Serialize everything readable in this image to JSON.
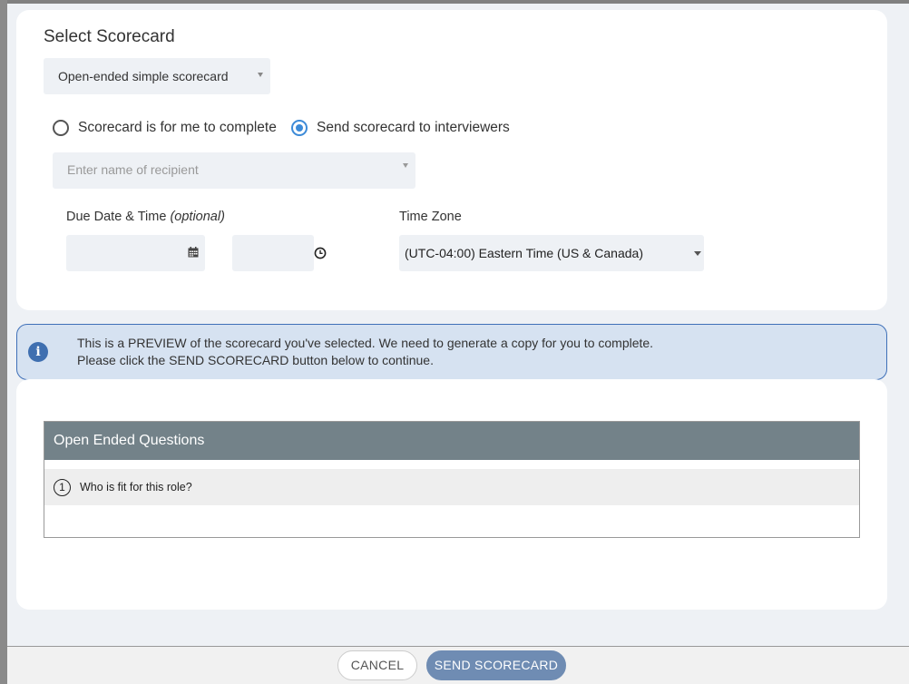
{
  "section_title": "Select Scorecard",
  "scorecard_select": {
    "value": "Open-ended simple scorecard"
  },
  "radios": {
    "self_complete": {
      "label": "Scorecard is for me to complete",
      "checked": false
    },
    "send_interviewers": {
      "label": "Send scorecard to interviewers",
      "checked": true
    }
  },
  "recipient": {
    "placeholder": "Enter name of recipient"
  },
  "due_date": {
    "label": "Due Date & Time",
    "optional": "(optional)",
    "date_value": "",
    "time_value": ""
  },
  "time_zone": {
    "label": "Time Zone",
    "value": "(UTC-04:00) Eastern Time (US & Canada)"
  },
  "info": {
    "line1": "This is a PREVIEW of the scorecard you've selected. We need to generate a copy for you to complete.",
    "line2": "Please click the SEND SCORECARD button below to continue."
  },
  "preview": {
    "header": "Open Ended Questions",
    "questions": [
      {
        "number": "1",
        "text": "Who is fit for this role?"
      }
    ]
  },
  "footer": {
    "cancel_label": "CANCEL",
    "send_label": "SEND SCORECARD"
  },
  "colors": {
    "accent": "#3d8bd8",
    "send_button": "#6f8cb3",
    "table_header": "#738289",
    "info_border": "#3f70b8"
  }
}
